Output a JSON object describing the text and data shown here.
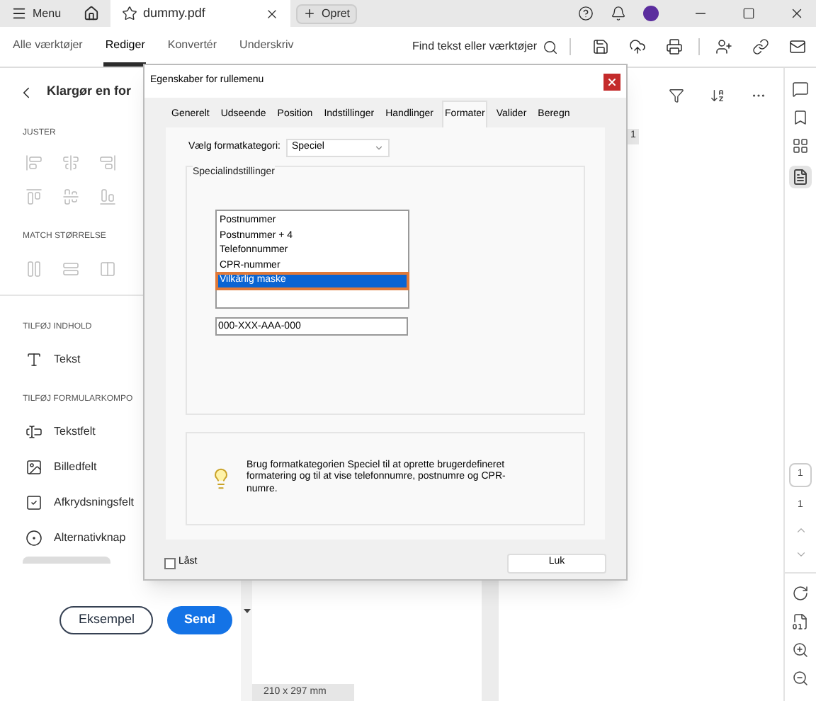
{
  "titlebar": {
    "menu": "Menu",
    "tab": {
      "title": "dummy.pdf"
    },
    "new_tab": "Opret"
  },
  "toolbar": {
    "tabs": [
      {
        "label": "Alle værktøjer",
        "selected": false
      },
      {
        "label": "Rediger",
        "selected": true
      },
      {
        "label": "Konvertér",
        "selected": false
      },
      {
        "label": "Underskriv",
        "selected": false
      }
    ],
    "search": "Find tekst eller værktøjer"
  },
  "left_panel": {
    "title": "Klargør en for",
    "align_heading": "JUSTER",
    "match_heading": "MATCH STØRRELSE",
    "content_heading": "TILFØJ INDHOLD",
    "text_tool": "Tekst",
    "form_heading": "TILFØJ FORMULARKOMPO",
    "form_items": [
      {
        "kind": "textfield",
        "label": "Tekstfelt"
      },
      {
        "kind": "image",
        "label": "Billedfelt"
      },
      {
        "kind": "checkbox",
        "label": "Afkrydsningsfelt"
      },
      {
        "kind": "radio",
        "label": "Alternativknap"
      }
    ],
    "buttons": [
      {
        "label": "Eksempel",
        "kind": "outline"
      },
      {
        "label": "Send",
        "kind": "primary"
      }
    ]
  },
  "document": {
    "field_chip": "1",
    "page_size": "210 x 297 mm"
  },
  "right_rail": {
    "page_input": "1",
    "page_count": "1"
  },
  "dialog": {
    "title": "Egenskaber for rullemenu",
    "tabs": [
      {
        "label": "Generelt",
        "selected": false
      },
      {
        "label": "Udseende",
        "selected": false
      },
      {
        "label": "Position",
        "selected": false
      },
      {
        "label": "Indstillinger",
        "selected": false
      },
      {
        "label": "Handlinger",
        "selected": false
      },
      {
        "label": "Formater",
        "selected": true
      },
      {
        "label": "Valider",
        "selected": false
      },
      {
        "label": "Beregn",
        "selected": false
      }
    ],
    "category_label": "Vælg formatkategori:",
    "category": "Speciel",
    "group_title": "Specialindstillinger",
    "options": [
      {
        "label": "Postnummer",
        "selected": false
      },
      {
        "label": "Postnummer + 4",
        "selected": false
      },
      {
        "label": "Telefonnummer",
        "selected": false
      },
      {
        "label": "CPR-nummer",
        "selected": false
      },
      {
        "label": "Vilkårlig maske",
        "selected": true
      }
    ],
    "mask": "000-XXX-AAA-000",
    "hint": "Brug formatkategorien Speciel til at oprette brugerdefineret formatering og til at vise telefonnumre, postnumre og CPR-numre.",
    "locked": {
      "label": "Låst",
      "checked": false
    },
    "close_button": "Luk"
  }
}
